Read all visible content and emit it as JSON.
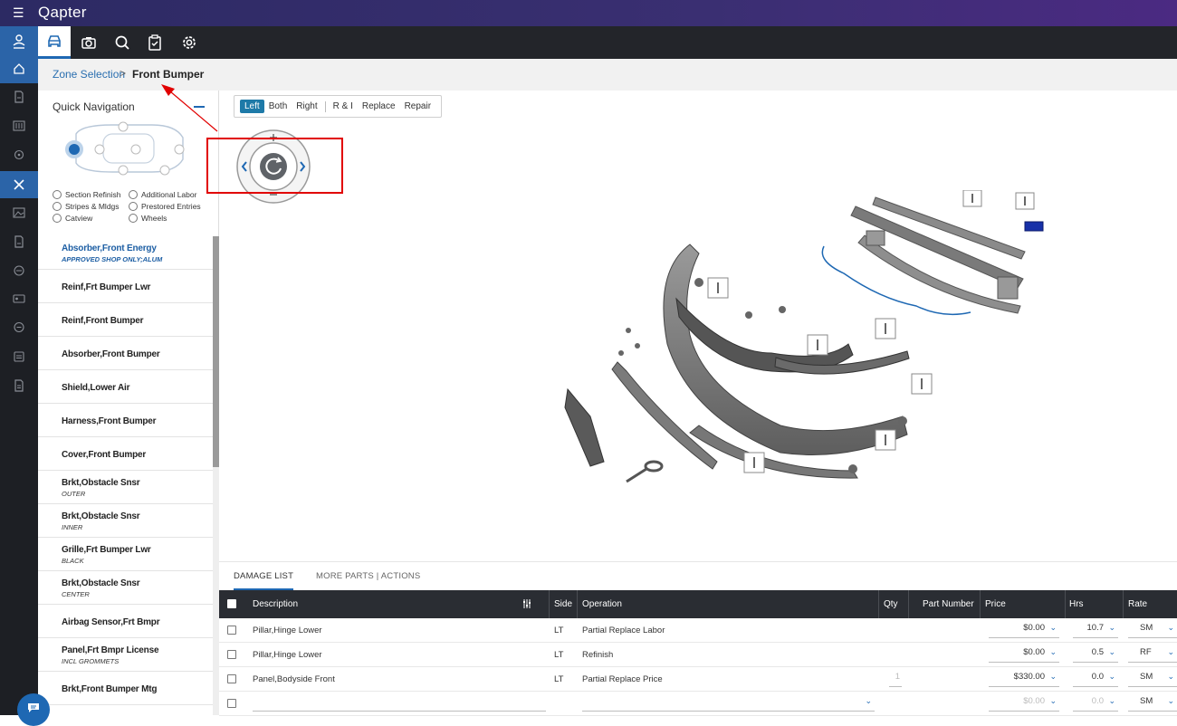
{
  "app": {
    "brand": "Qapter"
  },
  "breadcrumb": {
    "link": "Zone Selection",
    "sep": ">",
    "current": "Front Bumper"
  },
  "quick_nav": {
    "title": "Quick Navigation",
    "options": [
      "Section Refinish",
      "Additional Labor",
      "Stripes & Mldgs",
      "Prestored Entries",
      "Catview",
      "Wheels"
    ]
  },
  "parts": [
    {
      "name": "Absorber,Front Energy",
      "sub": "APPROVED SHOP ONLY;ALUM"
    },
    {
      "name": "Reinf,Frt Bumper Lwr",
      "sub": ""
    },
    {
      "name": "Reinf,Front Bumper",
      "sub": ""
    },
    {
      "name": "Absorber,Front Bumper",
      "sub": ""
    },
    {
      "name": "Shield,Lower Air",
      "sub": ""
    },
    {
      "name": "Harness,Front Bumper",
      "sub": ""
    },
    {
      "name": "Cover,Front Bumper",
      "sub": ""
    },
    {
      "name": "Brkt,Obstacle Snsr",
      "sub": "OUTER"
    },
    {
      "name": "Brkt,Obstacle Snsr",
      "sub": "INNER"
    },
    {
      "name": "Grille,Frt Bumper Lwr",
      "sub": "BLACK"
    },
    {
      "name": "Brkt,Obstacle Snsr",
      "sub": "CENTER"
    },
    {
      "name": "Airbag Sensor,Frt Bmpr",
      "sub": ""
    },
    {
      "name": "Panel,Frt Bmpr License",
      "sub": "INCL GROMMETS"
    },
    {
      "name": "Brkt,Front Bumper Mtg",
      "sub": ""
    }
  ],
  "side_buttons": [
    "Left",
    "Both",
    "Right",
    "R & I",
    "Replace",
    "Repair"
  ],
  "tabs": [
    "DAMAGE LIST",
    "MORE PARTS | ACTIONS"
  ],
  "grid": {
    "headers": {
      "description": "Description",
      "side": "Side",
      "operation": "Operation",
      "qty": "Qty",
      "part_number": "Part Number",
      "price": "Price",
      "hrs": "Hrs",
      "rate": "Rate"
    },
    "rows": [
      {
        "description": "Pillar,Hinge Lower",
        "side": "LT",
        "operation": "Partial Replace Labor",
        "qty": "",
        "price": "$0.00",
        "hrs": "10.7",
        "rate": "SM"
      },
      {
        "description": "Pillar,Hinge Lower",
        "side": "LT",
        "operation": "Refinish",
        "qty": "",
        "price": "$0.00",
        "hrs": "0.5",
        "rate": "RF"
      },
      {
        "description": "Panel,Bodyside Front",
        "side": "LT",
        "operation": "Partial Replace Price",
        "qty": "1",
        "price": "$330.00",
        "hrs": "0.0",
        "rate": "SM"
      },
      {
        "description": "",
        "side": "",
        "operation": "",
        "qty": "",
        "price": "$0.00",
        "hrs": "0.0",
        "rate": "SM"
      }
    ]
  },
  "colors": {
    "accent": "#1e68b3",
    "toolbar": "#23252a",
    "annotation": "#e10000"
  }
}
